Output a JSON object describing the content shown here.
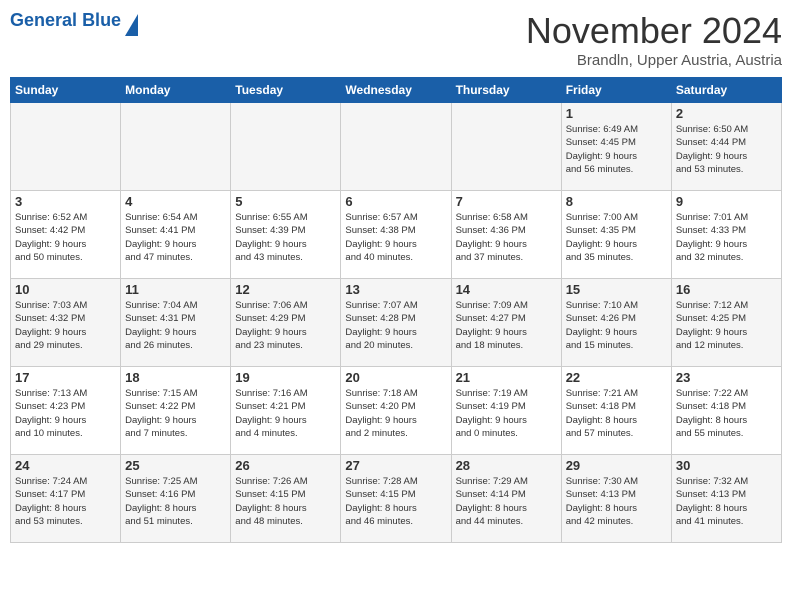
{
  "logo": {
    "line1": "General",
    "line2": "Blue"
  },
  "header": {
    "month": "November 2024",
    "location": "Brandln, Upper Austria, Austria"
  },
  "weekdays": [
    "Sunday",
    "Monday",
    "Tuesday",
    "Wednesday",
    "Thursday",
    "Friday",
    "Saturday"
  ],
  "weeks": [
    [
      {
        "day": "",
        "info": ""
      },
      {
        "day": "",
        "info": ""
      },
      {
        "day": "",
        "info": ""
      },
      {
        "day": "",
        "info": ""
      },
      {
        "day": "",
        "info": ""
      },
      {
        "day": "1",
        "info": "Sunrise: 6:49 AM\nSunset: 4:45 PM\nDaylight: 9 hours\nand 56 minutes."
      },
      {
        "day": "2",
        "info": "Sunrise: 6:50 AM\nSunset: 4:44 PM\nDaylight: 9 hours\nand 53 minutes."
      }
    ],
    [
      {
        "day": "3",
        "info": "Sunrise: 6:52 AM\nSunset: 4:42 PM\nDaylight: 9 hours\nand 50 minutes."
      },
      {
        "day": "4",
        "info": "Sunrise: 6:54 AM\nSunset: 4:41 PM\nDaylight: 9 hours\nand 47 minutes."
      },
      {
        "day": "5",
        "info": "Sunrise: 6:55 AM\nSunset: 4:39 PM\nDaylight: 9 hours\nand 43 minutes."
      },
      {
        "day": "6",
        "info": "Sunrise: 6:57 AM\nSunset: 4:38 PM\nDaylight: 9 hours\nand 40 minutes."
      },
      {
        "day": "7",
        "info": "Sunrise: 6:58 AM\nSunset: 4:36 PM\nDaylight: 9 hours\nand 37 minutes."
      },
      {
        "day": "8",
        "info": "Sunrise: 7:00 AM\nSunset: 4:35 PM\nDaylight: 9 hours\nand 35 minutes."
      },
      {
        "day": "9",
        "info": "Sunrise: 7:01 AM\nSunset: 4:33 PM\nDaylight: 9 hours\nand 32 minutes."
      }
    ],
    [
      {
        "day": "10",
        "info": "Sunrise: 7:03 AM\nSunset: 4:32 PM\nDaylight: 9 hours\nand 29 minutes."
      },
      {
        "day": "11",
        "info": "Sunrise: 7:04 AM\nSunset: 4:31 PM\nDaylight: 9 hours\nand 26 minutes."
      },
      {
        "day": "12",
        "info": "Sunrise: 7:06 AM\nSunset: 4:29 PM\nDaylight: 9 hours\nand 23 minutes."
      },
      {
        "day": "13",
        "info": "Sunrise: 7:07 AM\nSunset: 4:28 PM\nDaylight: 9 hours\nand 20 minutes."
      },
      {
        "day": "14",
        "info": "Sunrise: 7:09 AM\nSunset: 4:27 PM\nDaylight: 9 hours\nand 18 minutes."
      },
      {
        "day": "15",
        "info": "Sunrise: 7:10 AM\nSunset: 4:26 PM\nDaylight: 9 hours\nand 15 minutes."
      },
      {
        "day": "16",
        "info": "Sunrise: 7:12 AM\nSunset: 4:25 PM\nDaylight: 9 hours\nand 12 minutes."
      }
    ],
    [
      {
        "day": "17",
        "info": "Sunrise: 7:13 AM\nSunset: 4:23 PM\nDaylight: 9 hours\nand 10 minutes."
      },
      {
        "day": "18",
        "info": "Sunrise: 7:15 AM\nSunset: 4:22 PM\nDaylight: 9 hours\nand 7 minutes."
      },
      {
        "day": "19",
        "info": "Sunrise: 7:16 AM\nSunset: 4:21 PM\nDaylight: 9 hours\nand 4 minutes."
      },
      {
        "day": "20",
        "info": "Sunrise: 7:18 AM\nSunset: 4:20 PM\nDaylight: 9 hours\nand 2 minutes."
      },
      {
        "day": "21",
        "info": "Sunrise: 7:19 AM\nSunset: 4:19 PM\nDaylight: 9 hours\nand 0 minutes."
      },
      {
        "day": "22",
        "info": "Sunrise: 7:21 AM\nSunset: 4:18 PM\nDaylight: 8 hours\nand 57 minutes."
      },
      {
        "day": "23",
        "info": "Sunrise: 7:22 AM\nSunset: 4:18 PM\nDaylight: 8 hours\nand 55 minutes."
      }
    ],
    [
      {
        "day": "24",
        "info": "Sunrise: 7:24 AM\nSunset: 4:17 PM\nDaylight: 8 hours\nand 53 minutes."
      },
      {
        "day": "25",
        "info": "Sunrise: 7:25 AM\nSunset: 4:16 PM\nDaylight: 8 hours\nand 51 minutes."
      },
      {
        "day": "26",
        "info": "Sunrise: 7:26 AM\nSunset: 4:15 PM\nDaylight: 8 hours\nand 48 minutes."
      },
      {
        "day": "27",
        "info": "Sunrise: 7:28 AM\nSunset: 4:15 PM\nDaylight: 8 hours\nand 46 minutes."
      },
      {
        "day": "28",
        "info": "Sunrise: 7:29 AM\nSunset: 4:14 PM\nDaylight: 8 hours\nand 44 minutes."
      },
      {
        "day": "29",
        "info": "Sunrise: 7:30 AM\nSunset: 4:13 PM\nDaylight: 8 hours\nand 42 minutes."
      },
      {
        "day": "30",
        "info": "Sunrise: 7:32 AM\nSunset: 4:13 PM\nDaylight: 8 hours\nand 41 minutes."
      }
    ]
  ]
}
